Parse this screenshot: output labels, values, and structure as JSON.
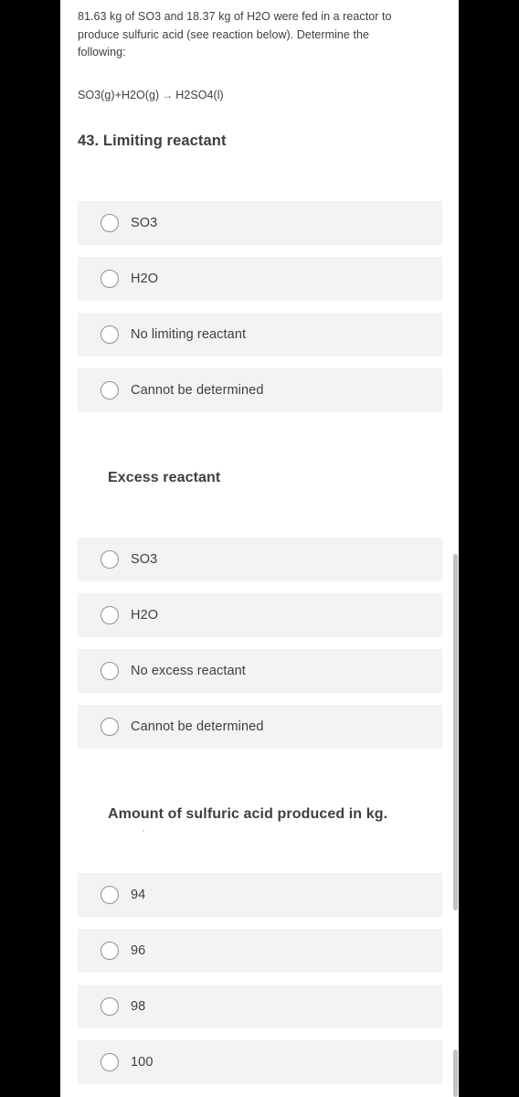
{
  "problem": {
    "intro": "81.63 kg of SO3 and 18.37 kg of H2O were fed in a reactor to produce sulfuric acid (see reaction below). Determine the following:",
    "equation_left": "SO3(g)+H2O(g)",
    "equation_arrow": "→",
    "equation_right": "H2SO4(l)"
  },
  "questions": [
    {
      "heading": "43. Limiting reactant",
      "options": [
        {
          "label": "SO3",
          "selected": false
        },
        {
          "label": "H2O",
          "selected": false
        },
        {
          "label": "No limiting reactant",
          "selected": false
        },
        {
          "label": "Cannot be determined",
          "selected": false
        }
      ]
    },
    {
      "heading": "Excess reactant",
      "options": [
        {
          "label": "SO3",
          "selected": false
        },
        {
          "label": "H2O",
          "selected": false
        },
        {
          "label": "No excess reactant",
          "selected": false
        },
        {
          "label": "Cannot be determined",
          "selected": false
        }
      ]
    },
    {
      "heading": "Amount of sulfuric acid produced in kg.",
      "options": [
        {
          "label": "94",
          "selected": false
        },
        {
          "label": "96",
          "selected": false
        },
        {
          "label": "98",
          "selected": false
        },
        {
          "label": "100",
          "selected": false
        }
      ]
    }
  ],
  "colors": {
    "page_background": "#ffffff",
    "letterbox": "#000000",
    "option_background": "#f3f3f4",
    "text": "#3c4043",
    "radio_border": "#8e9094",
    "scrollbar_thumb": "#c2c2c4"
  }
}
